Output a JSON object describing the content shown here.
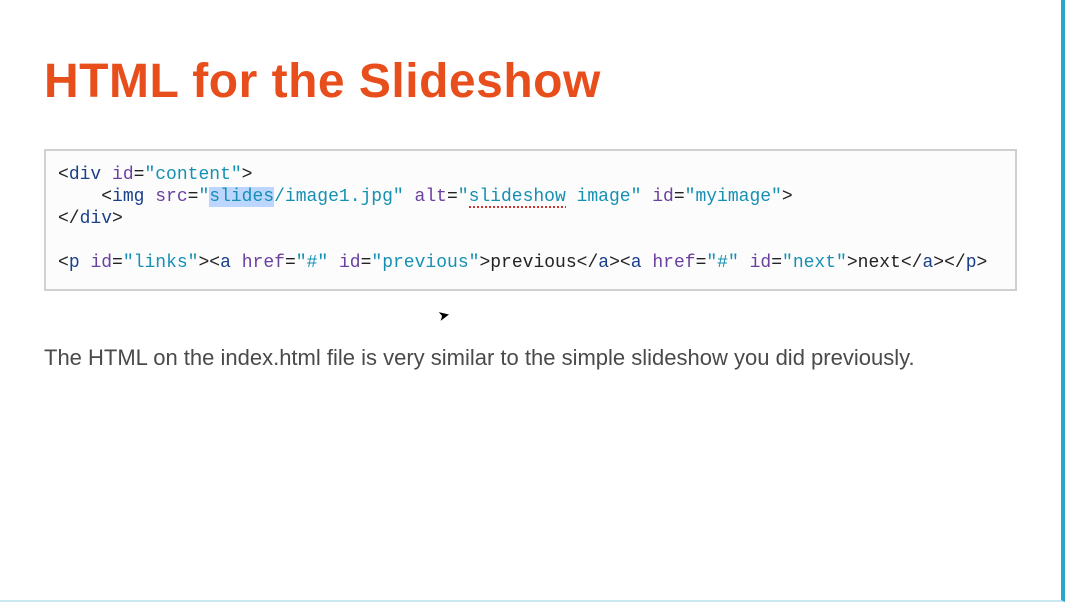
{
  "title": "HTML for the Slideshow",
  "code": {
    "l1": {
      "p1": "<",
      "tag1": "div",
      "sp1": " ",
      "attr1": "id",
      "eq1": "=",
      "str1": "\"content\"",
      "p2": ">"
    },
    "l2": {
      "indent": "    ",
      "p1": "<",
      "tag1": "img",
      "sp1": " ",
      "attr1": "src",
      "eq1": "=",
      "str1a": "\"",
      "str1b": "slides",
      "str1c": "/image1.jpg\"",
      "sp2": " ",
      "attr2": "alt",
      "eq2": "=",
      "str2a": "\"",
      "str2b": "slideshow",
      "str2c": " image\"",
      "sp3": " ",
      "attr3": "id",
      "eq3": "=",
      "str3": "\"myimage\"",
      "p2": ">"
    },
    "l3": {
      "p1": "</",
      "tag1": "div",
      "p2": ">"
    },
    "l4": "",
    "l5": {
      "p1": "<",
      "tag1": "p",
      "sp1": " ",
      "attr1": "id",
      "eq1": "=",
      "str1": "\"links\"",
      "p2": ">",
      "p3": "<",
      "tag2": "a",
      "sp2": " ",
      "attr2": "href",
      "eq2": "=",
      "str2": "\"#\"",
      "sp3": " ",
      "attr3": "id",
      "eq3": "=",
      "str3": "\"previous\"",
      "p4": ">",
      "txt1": "previous",
      "p5": "</",
      "tag3": "a",
      "p6": ">",
      "p7": "<",
      "tag4": "a",
      "sp4": " ",
      "attr4": "href",
      "eq4": "=",
      "str4": "\"#\"",
      "sp5": " ",
      "attr5": "id",
      "eq5": "=",
      "str5": "\"next\"",
      "p8": ">",
      "txt2": "next",
      "p9": "</",
      "tag5": "a",
      "p10": ">",
      "p11": "</",
      "tag6": "p",
      "p12": ">"
    }
  },
  "body_text": "The HTML on the index.html file is very similar to the simple slideshow you did previously."
}
